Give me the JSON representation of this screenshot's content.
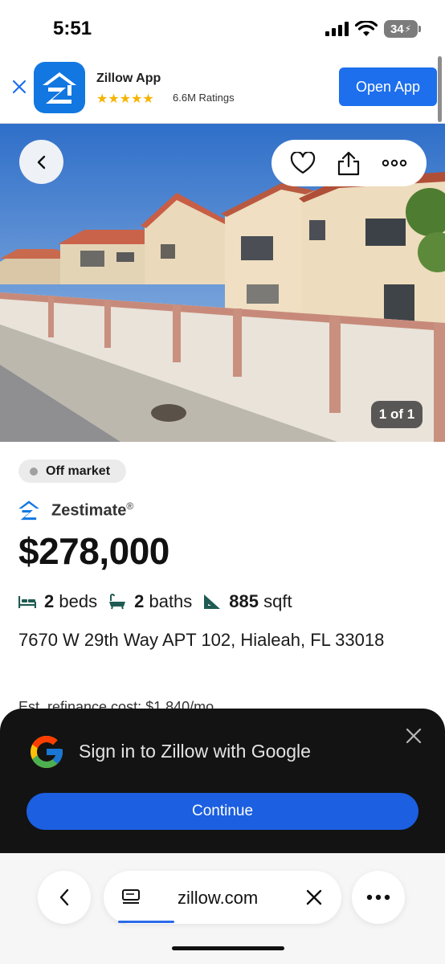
{
  "status_bar": {
    "time": "5:51",
    "battery": "34"
  },
  "app_banner": {
    "app_name": "Zillow App",
    "stars": "★★★★★",
    "ratings": "6.6M Ratings",
    "open_label": "Open App"
  },
  "photo": {
    "counter": "1 of 1"
  },
  "listing": {
    "status": "Off market",
    "zestimate_label": "Zestimate",
    "zestimate_reg": "®",
    "price": "$278,000",
    "beds_num": "2",
    "beds_label": "beds",
    "baths_num": "2",
    "baths_label": "baths",
    "sqft_num": "885",
    "sqft_label": "sqft",
    "address": "7670 W 29th Way APT 102, Hialeah, FL 33018",
    "est_payment_partial": "Est. refinance cost: $1,840/mo"
  },
  "google_signin": {
    "title": "Sign in to Zillow with Google",
    "continue_label": "Continue"
  },
  "browser": {
    "url": "zillow.com"
  },
  "colors": {
    "zillow_blue": "#1277e1",
    "banner_button": "#1d6fed",
    "google_button": "#1c5fe0",
    "sheet_bg": "#131314",
    "star": "#f5b400"
  }
}
